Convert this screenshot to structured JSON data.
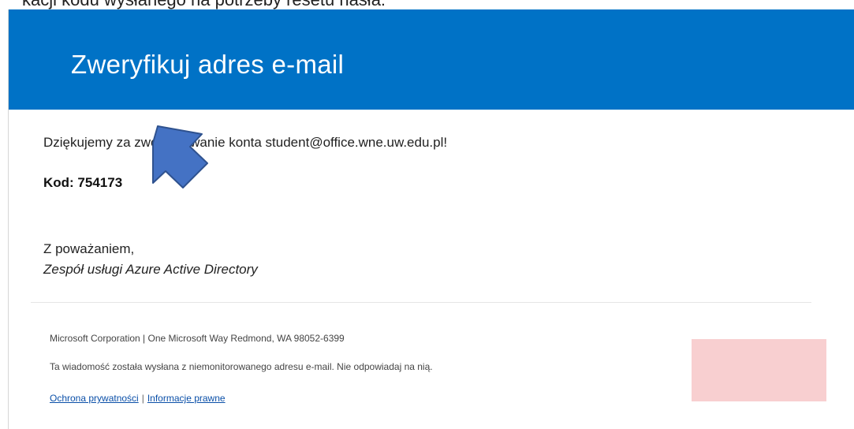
{
  "caption": {
    "text": "kacji kodu wysłanego na potrzeby resetu hasła:"
  },
  "email": {
    "header_title": "Zweryfikuj adres e-mail",
    "thanks_text": "Dziękujemy za zweryfikowanie konta student@office.wne.uw.edu.pl!",
    "code_text": "Kod: 754173",
    "regards_text": "Z poważaniem,",
    "team_text": "Zespół usługi Azure Active Directory",
    "footer": {
      "address": "Microsoft Corporation | One Microsoft Way Redmond, WA 98052-6399",
      "note": "Ta wiadomość została wysłana z niemonitorowanego adresu e-mail. Nie odpowiadaj na nią.",
      "privacy_link": "Ochrona prywatności",
      "separator": "|",
      "legal_link": "Informacje prawne"
    }
  },
  "colors": {
    "header_bg": "#0072c6",
    "arrow": "#4472c4",
    "redaction_box": "#f8cfd0"
  },
  "overlay": {
    "arrow_icon": "arrow-pointing-down-left"
  }
}
